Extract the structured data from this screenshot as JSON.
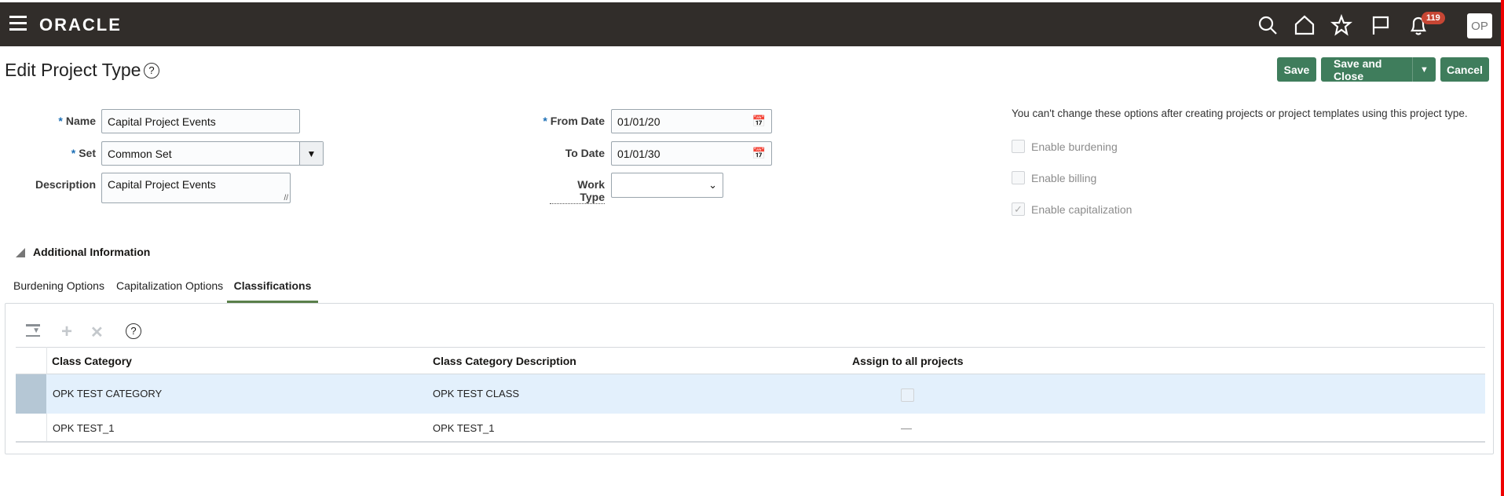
{
  "header": {
    "brand": "ORACLE",
    "notification_count": "119",
    "avatar": "OP",
    "icons": [
      "menu-icon",
      "search-icon",
      "home-icon",
      "star-icon",
      "flag-icon",
      "bell-icon"
    ]
  },
  "page": {
    "title": "Edit Project Type"
  },
  "buttons": {
    "save": "Save",
    "save_close": "Save and Close",
    "cancel": "Cancel"
  },
  "form": {
    "name_label": "Name",
    "name_value": "Capital Project Events",
    "set_label": "Set",
    "set_value": "Common Set",
    "description_label": "Description",
    "description_value": "Capital Project Events",
    "from_date_label": "From Date",
    "from_date_value": "01/01/20",
    "to_date_label": "To Date",
    "to_date_value": "01/01/30",
    "work_type_label": "Work Type",
    "work_type_value": ""
  },
  "options": {
    "note": "You can't change these options after creating projects or project templates using this project type.",
    "items": [
      {
        "label": "Enable burdening",
        "checked": false
      },
      {
        "label": "Enable billing",
        "checked": false
      },
      {
        "label": "Enable capitalization",
        "checked": true
      }
    ]
  },
  "additional": {
    "title": "Additional Information",
    "tabs": [
      "Burdening Options",
      "Capitalization Options",
      "Classifications"
    ],
    "active_tab": "Classifications"
  },
  "table": {
    "columns": [
      "Class Category",
      "Class Category Description",
      "Assign to all projects"
    ],
    "rows": [
      {
        "category": "OPK TEST CATEGORY",
        "description": "OPK TEST CLASS",
        "assign": "checkbox"
      },
      {
        "category": "OPK TEST_1",
        "description": "OPK TEST_1",
        "assign": "—"
      }
    ]
  }
}
